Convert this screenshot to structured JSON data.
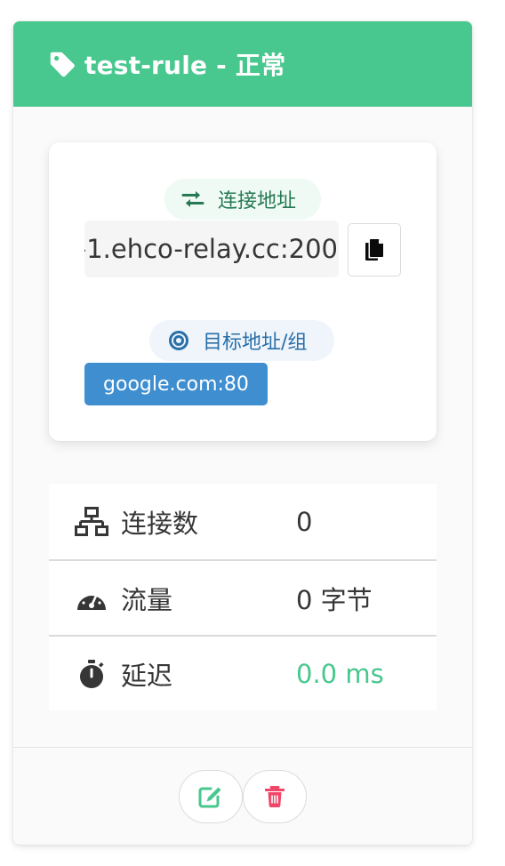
{
  "header": {
    "title": "test-rule - 正常",
    "icon": "tag-icon"
  },
  "connection": {
    "label": "连接地址",
    "address": "-1.ehco-relay.cc:200",
    "copy_icon": "copy-icon"
  },
  "target": {
    "label": "目标地址/组",
    "value": "google.com:80"
  },
  "stats": [
    {
      "icon": "network-icon",
      "label": "连接数",
      "value": "0"
    },
    {
      "icon": "gauge-icon",
      "label": "流量",
      "value": "0 字节"
    },
    {
      "icon": "stopwatch-icon",
      "label": "延迟",
      "value": "0.0 ms"
    }
  ],
  "footer": {
    "edit_icon": "edit-icon",
    "delete_icon": "trash-icon"
  },
  "colors": {
    "header": "#48c78e",
    "success_text": "#257953",
    "info_text": "#296fa8",
    "info_tag": "#3e8ed0",
    "latency": "#48c78e",
    "delete": "#f14668"
  }
}
